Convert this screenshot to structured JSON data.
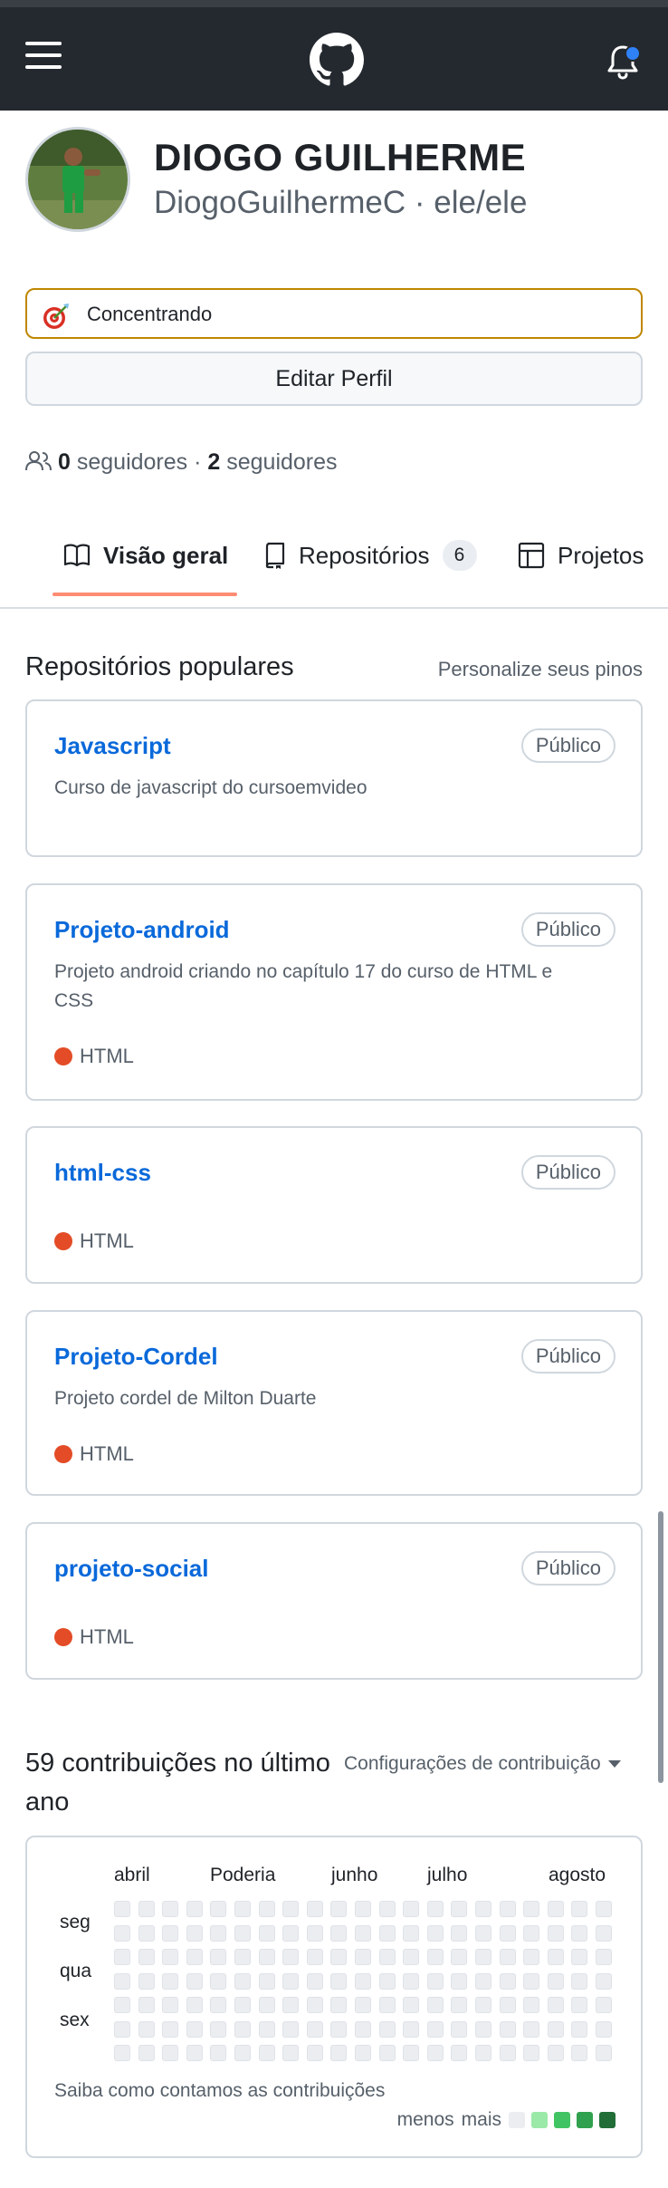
{
  "header": {
    "menu_icon": "hamburger-menu-icon",
    "logo_icon": "github-mark-icon",
    "notifications_icon": "bell-icon",
    "colors": {
      "background": "#24292f",
      "notification_dot": "#2f81f7"
    }
  },
  "profile": {
    "full_name": "DIOGO GUILHERME",
    "username_line": "DiogoGuilhermeC · ele/ele",
    "status_text": "Concentrando",
    "status_icon": "target-emoji-icon",
    "edit_button": "Editar Perfil",
    "followers_count": "0",
    "followers_label": " seguidores · ",
    "following_count": "2",
    "following_label": " seguidores"
  },
  "tabs": [
    {
      "label": "Visão geral",
      "icon": "book-icon",
      "active": true
    },
    {
      "label": "Repositórios",
      "icon": "repo-icon",
      "count": "6"
    },
    {
      "label": "Projetos",
      "icon": "table-icon"
    }
  ],
  "popular": {
    "title": "Repositórios populares",
    "customize_link": "Personalize seus pinos",
    "repos": [
      {
        "name": "Javascript",
        "visibility": "Público",
        "description": "Curso de javascript do cursoemvideo",
        "language": ""
      },
      {
        "name": "Projeto-android",
        "visibility": "Público",
        "description": "Projeto android criando no capítulo 17 do curso de HTML e CSS",
        "language": "HTML"
      },
      {
        "name": "html-css",
        "visibility": "Público",
        "description": "",
        "language": "HTML"
      },
      {
        "name": "Projeto-Cordel",
        "visibility": "Público",
        "description": "Projeto cordel de Milton Duarte",
        "language": "HTML"
      },
      {
        "name": "projeto-social",
        "visibility": "Público",
        "description": "",
        "language": "HTML"
      }
    ],
    "language_color": "#e34c26"
  },
  "contributions": {
    "title": "59 contribuições no último ano",
    "settings_link": "Configurações de contribuição",
    "months": [
      "abril",
      "Poderia",
      "junho",
      "julho",
      "agosto"
    ],
    "weekdays": [
      "seg",
      "qua",
      "sex"
    ],
    "learn_link": "Saiba como contamos as contribuições",
    "legend_less": "menos",
    "legend_more": "mais",
    "legend_colors": [
      "#ebedf0",
      "#9be9a8",
      "#40c463",
      "#30a14e",
      "#216e39"
    ]
  }
}
